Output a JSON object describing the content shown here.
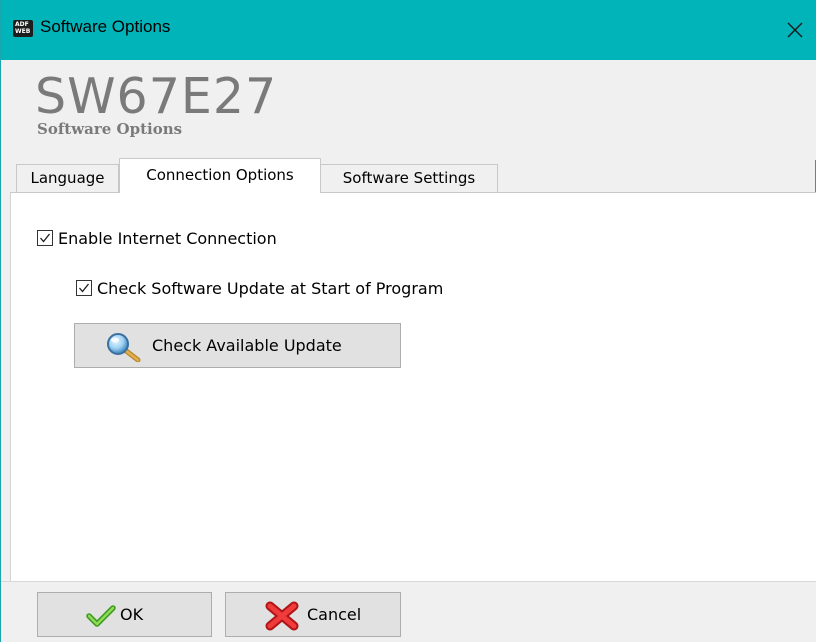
{
  "window": {
    "title": "Software Options",
    "icon_name": "adfweb-app-icon",
    "icon_text_top": "ADF",
    "icon_text_bottom": "WEB",
    "title_bar_color": "#00b4b9"
  },
  "header": {
    "product_name": "SW67E27",
    "subtitle": "Software Options"
  },
  "tabs": [
    {
      "label": "Language",
      "active": false
    },
    {
      "label": "Connection Options",
      "active": true
    },
    {
      "label": "Software Settings",
      "active": false
    }
  ],
  "connection": {
    "enable_internet": {
      "label": "Enable Internet Connection",
      "checked": true
    },
    "check_update_at_start": {
      "label": "Check Software Update at Start of Program",
      "checked": true
    },
    "check_button": {
      "label": "Check Available Update",
      "icon": "magnifier-icon"
    }
  },
  "footer": {
    "ok": {
      "label": "OK",
      "icon": "checkmark-icon"
    },
    "cancel": {
      "label": "Cancel",
      "icon": "red-x-icon"
    }
  }
}
